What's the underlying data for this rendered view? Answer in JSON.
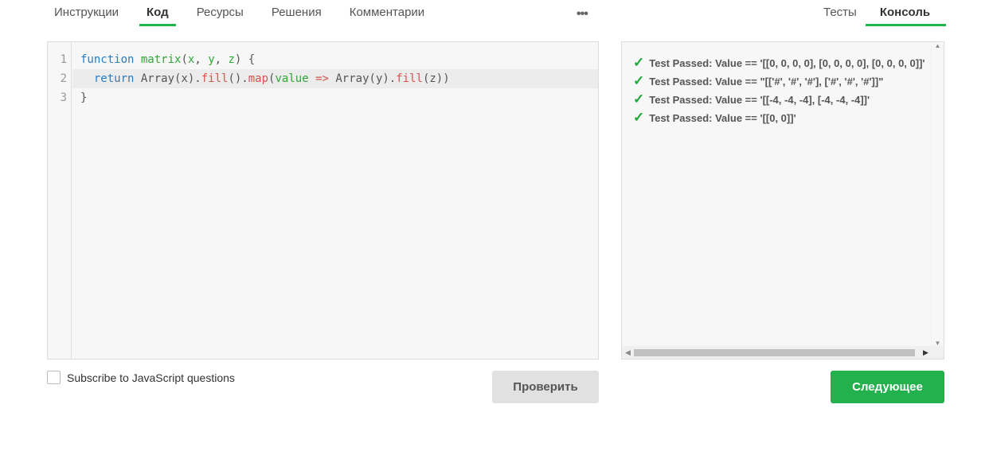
{
  "tabs_left": [
    {
      "label": "Инструкции"
    },
    {
      "label": "Код"
    },
    {
      "label": "Ресурсы"
    },
    {
      "label": "Решения"
    },
    {
      "label": "Комментарии"
    }
  ],
  "more_icon": "•••",
  "tabs_right": [
    {
      "label": "Тесты"
    },
    {
      "label": "Консоль"
    }
  ],
  "editor": {
    "line_numbers": [
      "1",
      "2",
      "3"
    ],
    "lines": [
      "function matrix(x, y, z) {",
      "  return Array(x).fill().map(value => Array(y).fill(z))",
      "}"
    ]
  },
  "console": {
    "check_icon": "✓",
    "lines": [
      "Test Passed: Value == '[[0, 0, 0, 0], [0, 0, 0, 0], [0, 0, 0, 0]]'",
      "Test Passed: Value == \"[['#', '#', '#'], ['#', '#', '#']]\"",
      "Test Passed: Value == '[[-4, -4, -4], [-4, -4, -4]]'",
      "Test Passed: Value == '[[0, 0]]'"
    ]
  },
  "subscribe_label": "Subscribe to JavaScript questions",
  "check_button": "Проверить",
  "next_button": "Следующее",
  "colors": {
    "accent": "#22b14c",
    "keyword": "#2a7cc2",
    "method": "#d9534f"
  }
}
